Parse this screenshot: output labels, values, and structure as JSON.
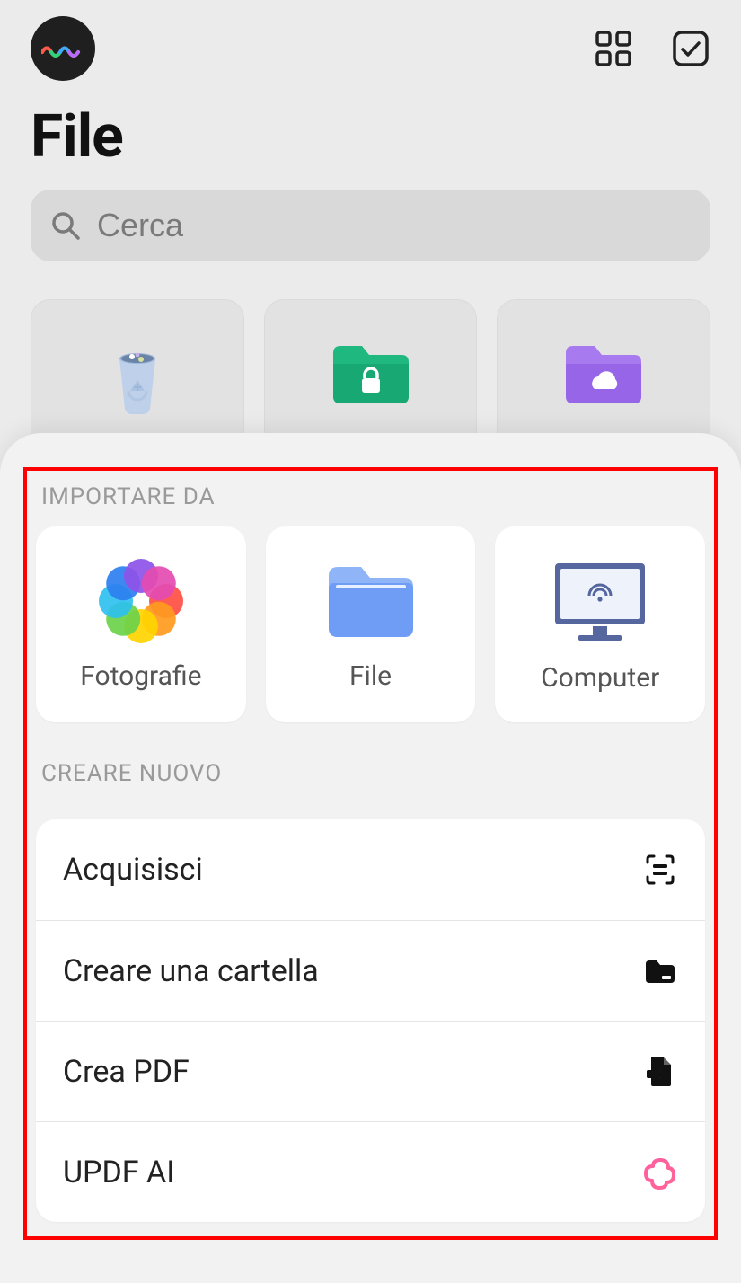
{
  "header": {
    "title": "File"
  },
  "search": {
    "placeholder": "Cerca"
  },
  "folders": [
    {
      "id": "trash"
    },
    {
      "id": "locked"
    },
    {
      "id": "cloud"
    }
  ],
  "sheet": {
    "import_label": "IMPORTARE DA",
    "import_options": [
      {
        "icon": "photos",
        "label": "Fotografie"
      },
      {
        "icon": "files",
        "label": "File"
      },
      {
        "icon": "computer",
        "label": "Computer"
      }
    ],
    "create_label": "CREARE NUOVO",
    "create_options": [
      {
        "icon": "scan",
        "label": "Acquisisci"
      },
      {
        "icon": "folder",
        "label": "Creare una cartella"
      },
      {
        "icon": "pdf",
        "label": "Crea PDF"
      },
      {
        "icon": "updf-ai",
        "label": "UPDF AI"
      }
    ]
  }
}
